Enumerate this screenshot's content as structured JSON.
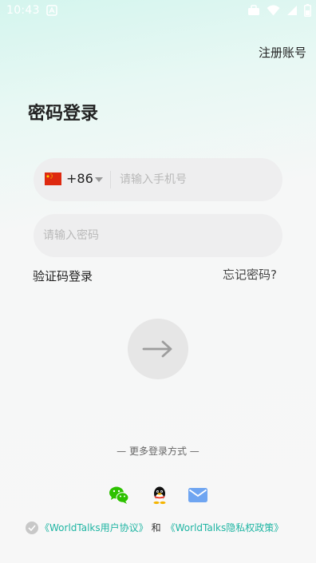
{
  "status_bar": {
    "time": "10:43",
    "icons": [
      "app-store-icon",
      "briefcase-icon",
      "wifi-icon",
      "signal-icon",
      "battery-icon"
    ]
  },
  "header": {
    "register_label": "注册账号",
    "title": "密码登录"
  },
  "phone": {
    "flag": "cn-flag-icon",
    "country_code": "+86",
    "placeholder": "请输入手机号",
    "value": ""
  },
  "password": {
    "placeholder": "请输入密码",
    "value": ""
  },
  "links": {
    "sms_login": "验证码登录",
    "forgot_password": "忘记密码?"
  },
  "submit": {
    "icon": "arrow-right-icon"
  },
  "more_login": {
    "label": "— 更多登录方式 —",
    "options": [
      "wechat-icon",
      "qq-icon",
      "mail-icon"
    ]
  },
  "agreement": {
    "checked": false,
    "user_agreement": "《WorldTalks用户协议》",
    "and": "和",
    "privacy_policy": "《WorldTalks隐私权政策》"
  },
  "colors": {
    "accent": "#1fb5a3",
    "wechat": "#2dc100",
    "mail": "#6fa5f1"
  }
}
